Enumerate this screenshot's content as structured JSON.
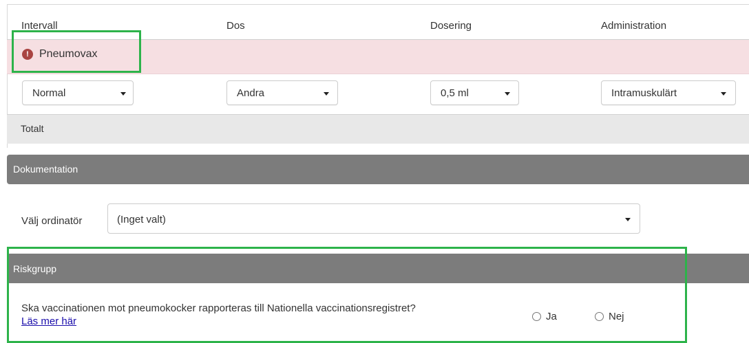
{
  "columns": {
    "interval": "Intervall",
    "dose": "Dos",
    "dosage": "Dosering",
    "administration": "Administration"
  },
  "vaccine": {
    "name": "Pneumovax",
    "alert_icon": "exclamation-circle",
    "alert_glyph": "!"
  },
  "selects": {
    "interval": "Normal",
    "dose": "Andra",
    "dosage": "0,5 ml",
    "administration": "Intramuskulärt"
  },
  "totals": {
    "label": "Totalt"
  },
  "documentation": {
    "title": "Dokumentation",
    "orderer_label": "Välj ordinatör",
    "orderer_value": "(Inget valt)"
  },
  "risk_group": {
    "title": "Riskgrupp",
    "question": "Ska vaccinationen mot pneumokocker rapporteras till Nationella vaccinationsregistret?",
    "read_more": "Läs mer här",
    "option_yes": "Ja",
    "option_no": "Nej"
  },
  "colors": {
    "alert_row": "#f6dfe2",
    "alert_icon": "#a94442",
    "section_header": "#7c7c7c",
    "highlight": "#2db34a",
    "link": "#1a0dab"
  }
}
